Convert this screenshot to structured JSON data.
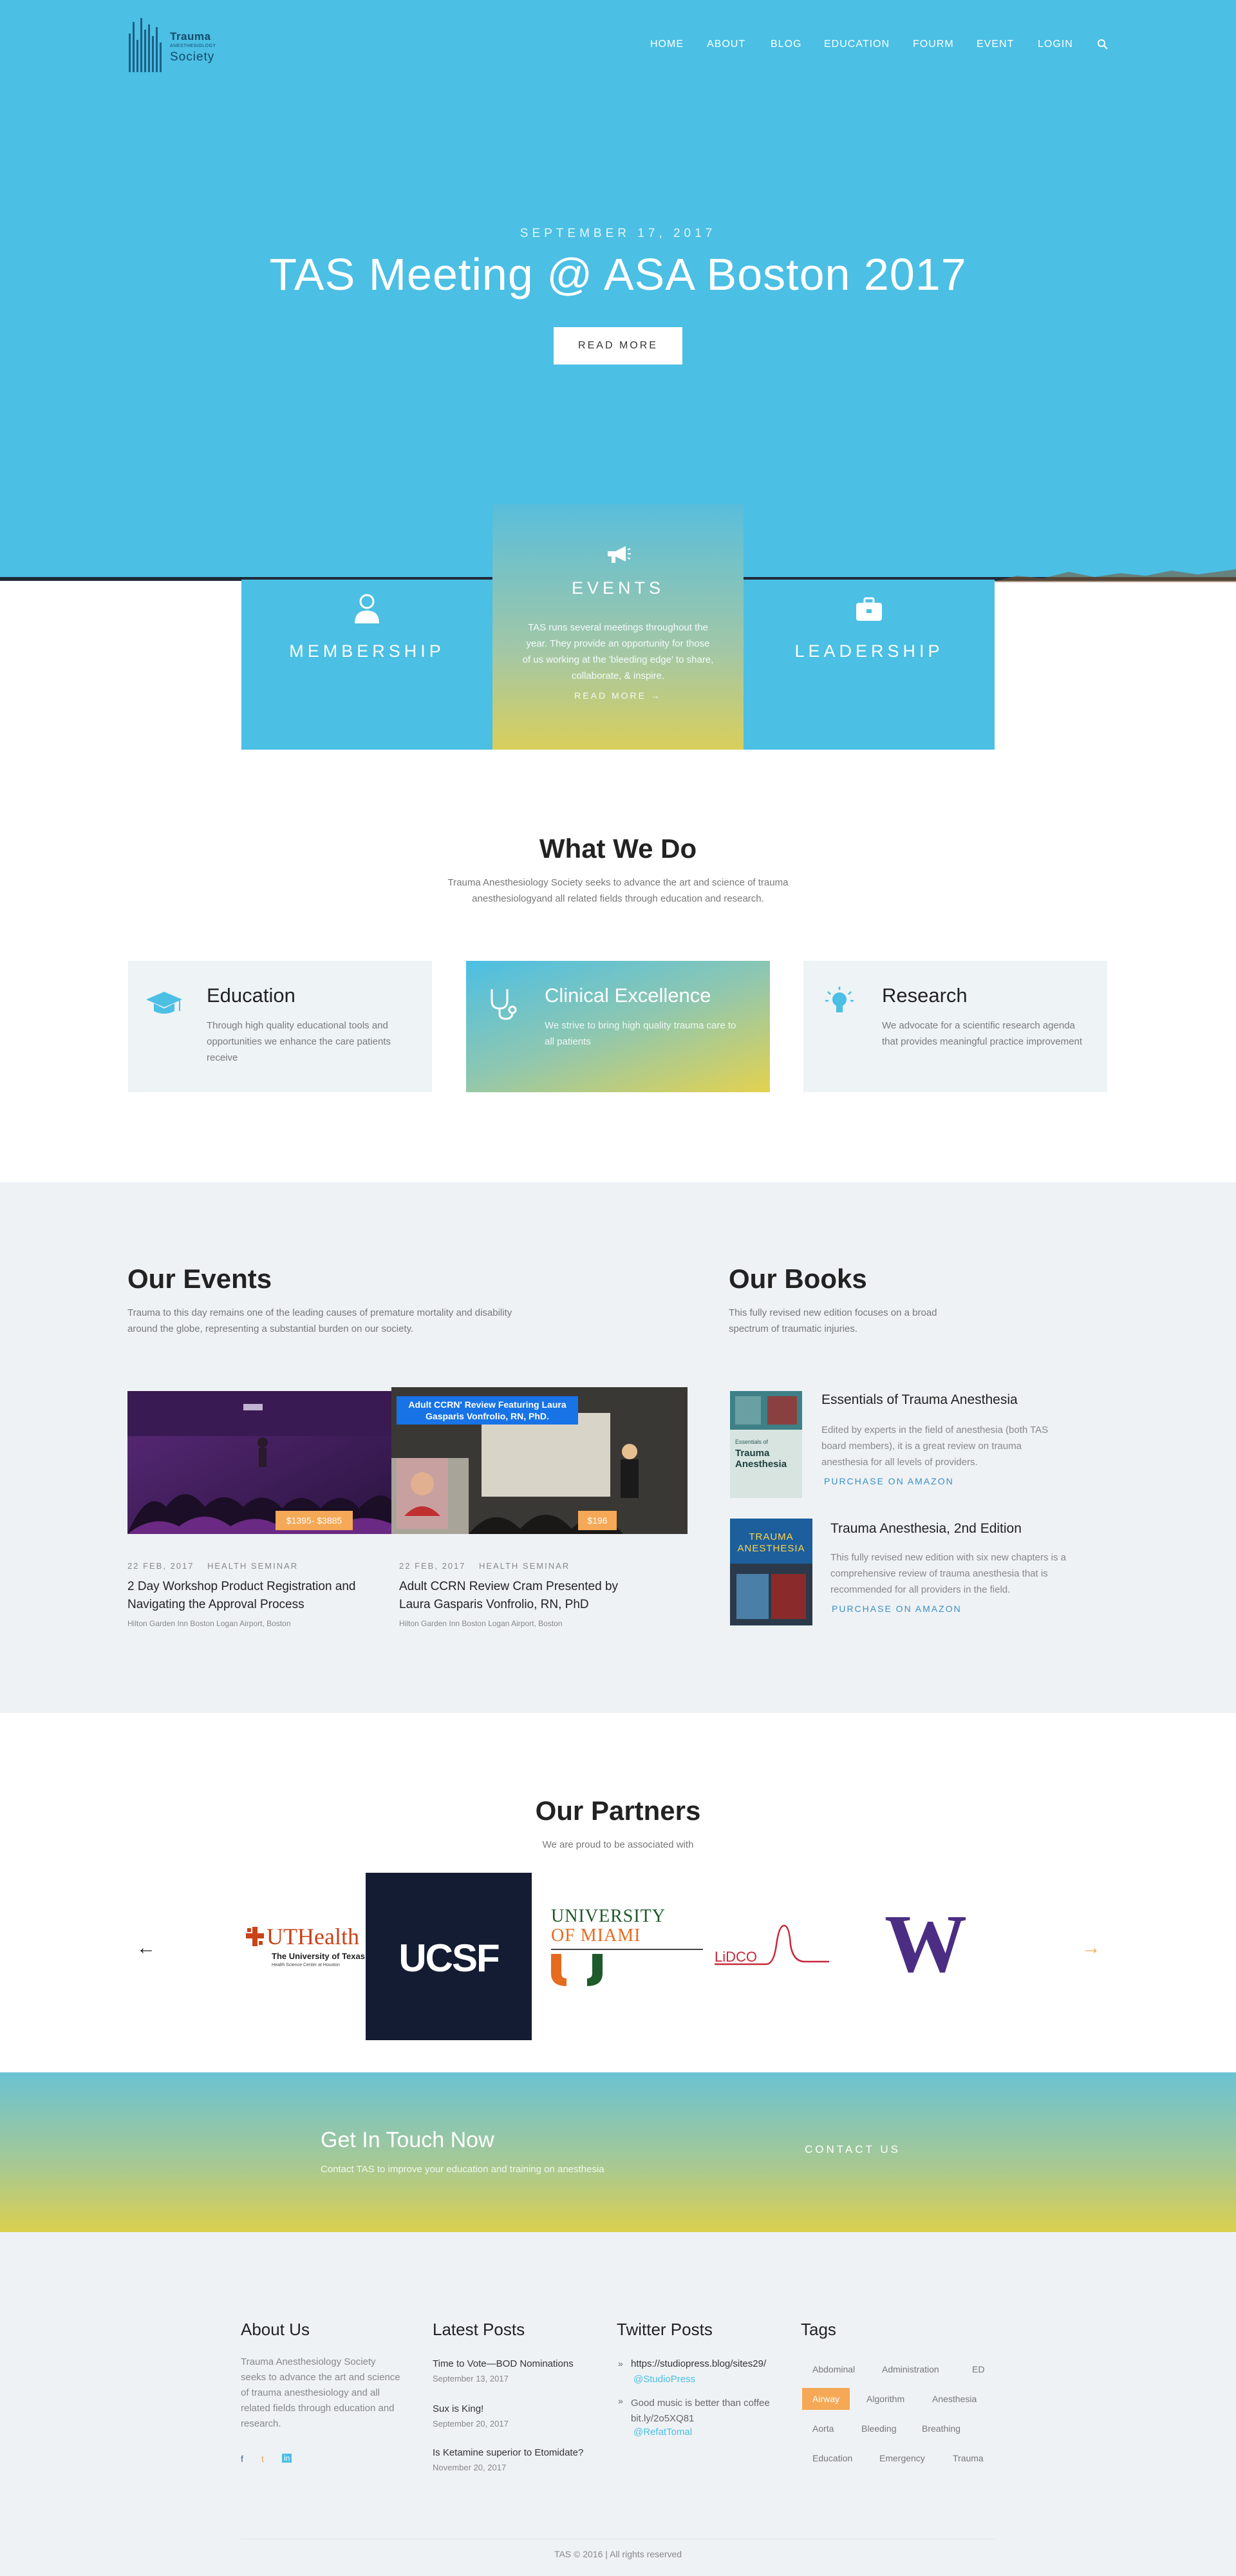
{
  "brand": {
    "line1": "Trauma",
    "line2": "ANESTHESIOLOGY",
    "line3": "Society"
  },
  "nav": {
    "items": [
      "HOME",
      "ABOUT",
      "BLOG",
      "EDUCATION",
      "FOURM",
      "EVENT",
      "LOGIN"
    ],
    "search_icon": "search-icon"
  },
  "hero": {
    "date": "SEPTEMBER 17, 2017",
    "title": "TAS Meeting @ ASA Boston 2017",
    "button": "READ MORE"
  },
  "features": {
    "membership": {
      "title": "MEMBERSHIP",
      "icon": "user-icon"
    },
    "events": {
      "title": "EVENTS",
      "icon": "megaphone-icon",
      "desc": "TAS runs several meetings throughout the year. They provide an opportunity for those of us working at the 'bleeding edge' to share, collaborate, & inspire.",
      "more": "READ MORE →"
    },
    "leadership": {
      "title": "LEADERSHIP",
      "icon": "briefcase-icon"
    }
  },
  "what_we_do": {
    "title": "What We Do",
    "subtitle": "Trauma Anesthesiology Society seeks to advance the art and science of trauma anesthesiologyand all related fields through education and research.",
    "cards": [
      {
        "title": "Education",
        "desc": "Through high quality educational tools and opportunities we enhance the care patients receive",
        "icon": "graduation-cap-icon"
      },
      {
        "title": "Clinical Excellence",
        "desc": "We strive to bring high quality trauma care to all patients",
        "icon": "stethoscope-icon"
      },
      {
        "title": "Research",
        "desc": "We advocate for a scientific research agenda that provides meaningful practice improvement",
        "icon": "lightbulb-icon"
      }
    ]
  },
  "events": {
    "title": "Our Events",
    "subtitle": "Trauma to this day remains one of the leading causes of premature mortality and disability around the globe, representing a substantial burden on our society.",
    "items": [
      {
        "price": "$1395- $3885",
        "date": "22 FEB, 2017",
        "category": "HEALTH SEMINAR",
        "title": "2 Day Workshop Product Registration and Navigating the Approval Process",
        "location": "Hilton Garden Inn Boston Logan Airport, Boston"
      },
      {
        "price": "$196",
        "date": "22 FEB, 2017",
        "category": "HEALTH SEMINAR",
        "title": "Adult CCRN Review Cram Presented by Laura Gasparis Vonfrolio, RN, PhD",
        "location": "Hilton Garden Inn Boston Logan Airport, Boston",
        "banner": "Adult CCRN' Review Featuring Laura Gasparis Vonfrolio, RN, PhD."
      }
    ]
  },
  "books": {
    "title": "Our Books",
    "subtitle": "This fully revised new edition focuses on a broad spectrum of traumatic injuries.",
    "items": [
      {
        "title": "Essentials of Trauma Anesthesia",
        "desc": "Edited by experts in the field of anesthesia (both TAS board members), it is a great review on trauma anesthesia for all levels of providers.",
        "link": "PURCHASE ON AMAZON",
        "cover_line1": "Essentials of",
        "cover_line2": "Trauma Anesthesia"
      },
      {
        "title": "Trauma Anesthesia, 2nd Edition",
        "desc": "This fully revised new edition with six new chapters is a comprehensive review of trauma anesthesia that is recommended for all providers in the field.",
        "link": "PURCHASE ON AMAZON",
        "cover_line1": "TRAUMA",
        "cover_line2": "ANESTHESIA"
      }
    ]
  },
  "partners": {
    "title": "Our Partners",
    "subtitle": "We are proud to be associated with",
    "logos": {
      "uthealth": "UTHealth",
      "uthealth_sub": "The University of Texas",
      "uthealth_sub2": "Health Science Center at Houston",
      "ucsf": "UCSF",
      "miami1": "UNIVERSITY",
      "miami2": "OF MIAMI",
      "lidco": "LiDCO",
      "uw": "W"
    },
    "prev": "←",
    "next": "→"
  },
  "cta": {
    "title": "Get In Touch Now",
    "subtitle": "Contact TAS to improve your education and training on anesthesia",
    "button": "CONTACT US"
  },
  "footer": {
    "about": {
      "title": "About Us",
      "text": "Trauma Anesthesiology Society seeks to advance the art and science of trauma anesthesiology and all related fields through education and research.",
      "social": [
        "f",
        "t",
        "in"
      ]
    },
    "posts": {
      "title": "Latest Posts",
      "items": [
        {
          "title": "Time to Vote—BOD Nominations",
          "date": "September 13, 2017"
        },
        {
          "title": "Sux is King!",
          "date": "September 20, 2017"
        },
        {
          "title": "Is Ketamine superior to Etomidate?",
          "date": "November 20, 2017"
        }
      ]
    },
    "twitter": {
      "title": "Twitter Posts",
      "items": [
        {
          "text": "https://studiopress.blog/sites29/",
          "handle": "@StudioPress"
        },
        {
          "text": "Good music is better than coffee bit.ly/2o5XQ81",
          "handle": "@RefatTomal"
        }
      ]
    },
    "tags": {
      "title": "Tags",
      "items": [
        "Abdominal",
        "Administration",
        "ED",
        "Airway",
        "Algorithm",
        "Anesthesia",
        "Aorta",
        "Bleeding",
        "Breathing",
        "Education",
        "Emergency",
        "Trauma"
      ]
    },
    "copyright": "TAS © 2016 | All rights reserved"
  },
  "colors": {
    "primary": "#4bbfe4",
    "accent": "#f5a855",
    "link": "#3a8fc4"
  }
}
